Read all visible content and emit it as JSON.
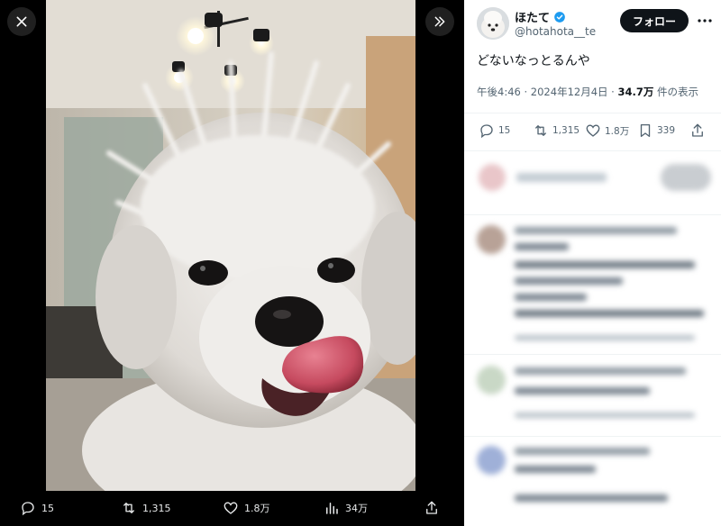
{
  "viewer": {
    "close_icon": "close-icon",
    "expand_icon": "double-chevron-right-icon",
    "stats": {
      "replies": "15",
      "reposts": "1,315",
      "likes": "1.8万",
      "views": "34万"
    }
  },
  "tweet": {
    "display_name": "ほたて",
    "handle": "@hotahota__te",
    "follow_label": "フォロー",
    "text": "どないなっとるんや",
    "time": "午後4:46",
    "separator": " · ",
    "date": "2024年12月4日",
    "views_count": "34.7万",
    "views_label": " 件の表示",
    "replies": "15",
    "reposts": "1,315",
    "likes": "1.8万",
    "bookmarks": "339"
  },
  "colors": {
    "verified_badge": "#1d9bf0",
    "follow_button": "#0f1419",
    "muted_text": "#536471"
  }
}
